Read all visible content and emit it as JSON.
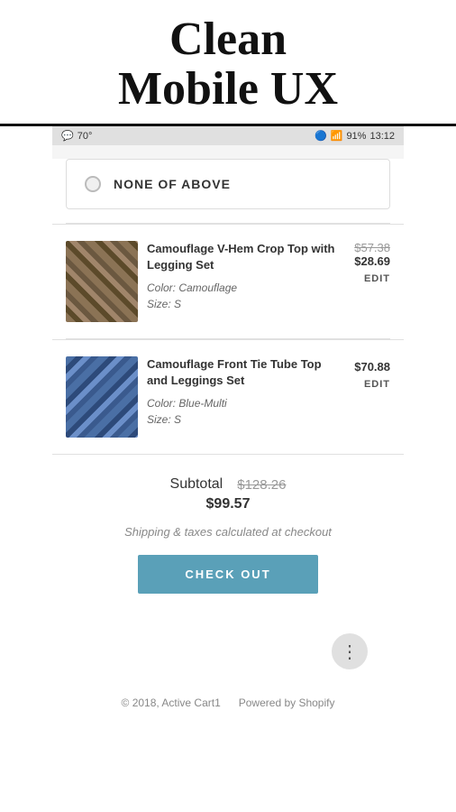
{
  "header": {
    "title_line1": "Clean",
    "title_line2": "Mobile UX"
  },
  "status_bar": {
    "chat_icon": "💬",
    "signal": "70°",
    "icons": "🔵🔇📶",
    "battery": "91%",
    "time": "13:12"
  },
  "none_above": {
    "label": "NONE OF ABOVE"
  },
  "products": [
    {
      "name": "Camouflage V-Hem Crop Top with Legging Set",
      "color": "Color: Camouflage",
      "size": "Size: S",
      "price_original": "$57.38",
      "price_sale": "$28.69",
      "edit_label": "EDIT",
      "pattern": "camo-pattern-1"
    },
    {
      "name": "Camouflage Front Tie Tube Top and Leggings Set",
      "color": "Color: Blue-Multi",
      "size": "Size: S",
      "price_original": null,
      "price_sale": "$70.88",
      "edit_label": "EDIT",
      "pattern": "camo-pattern-2"
    }
  ],
  "subtotal": {
    "label": "Subtotal",
    "original": "$128.26",
    "sale": "$99.57"
  },
  "shipping_note": "Shipping & taxes calculated at checkout",
  "checkout_button": "CHECK OUT",
  "footer": {
    "copyright": "© 2018, Active Cart1",
    "powered_by": "Powered by Shopify"
  }
}
